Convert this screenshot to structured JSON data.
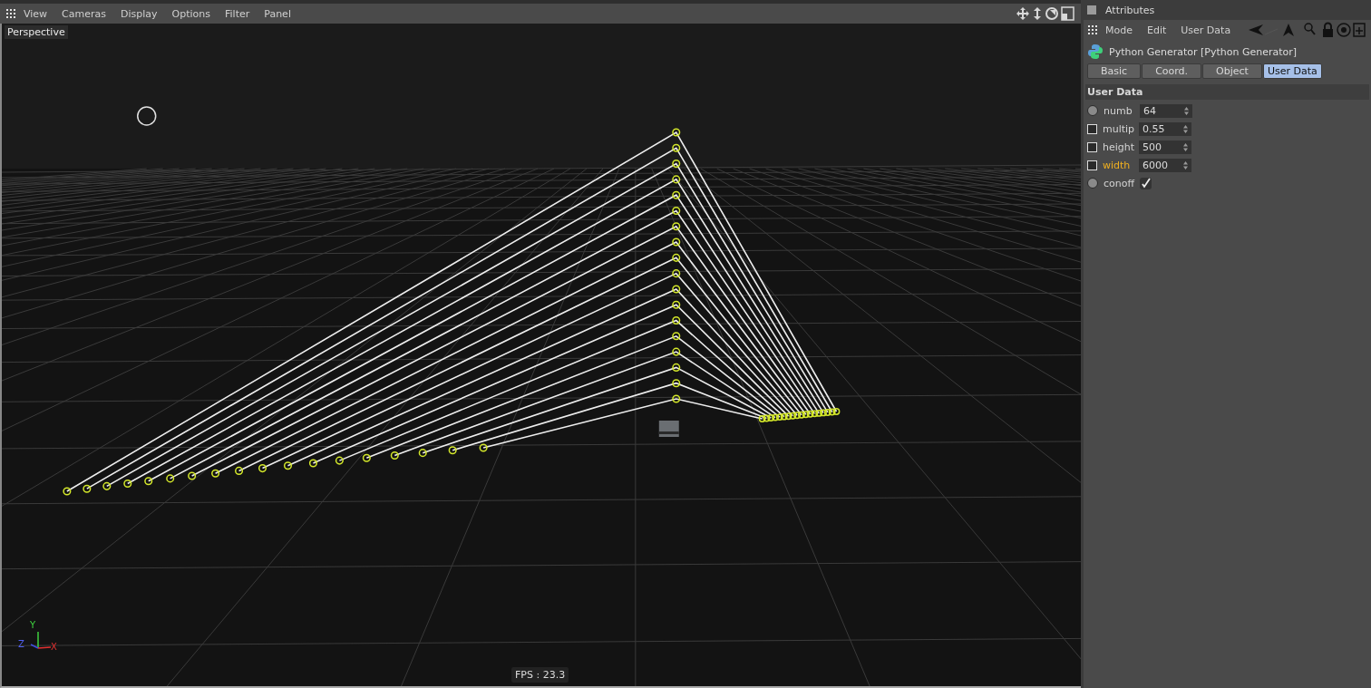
{
  "viewport": {
    "menu": [
      "View",
      "Cameras",
      "Display",
      "Options",
      "Filter",
      "Panel"
    ],
    "camera_label": "Perspective",
    "axis_labels": {
      "y": "Y",
      "z": "Z",
      "x": "X"
    },
    "fps": "FPS : 23.3"
  },
  "attributes": {
    "title": "Attributes",
    "menu": [
      "Mode",
      "Edit",
      "User Data"
    ],
    "object_name": "Python Generator [Python Generator]",
    "tabs": [
      {
        "label": "Basic",
        "selected": false
      },
      {
        "label": "Coord.",
        "selected": false
      },
      {
        "label": "Object",
        "selected": false
      },
      {
        "label": "User Data",
        "selected": true
      }
    ],
    "section": "User Data",
    "params": [
      {
        "kind": "number",
        "label": "numb",
        "value": "64",
        "keyframed": false,
        "highlighted": false
      },
      {
        "kind": "number",
        "label": "multip",
        "value": "0.55",
        "keyframed": true,
        "highlighted": false
      },
      {
        "kind": "number",
        "label": "height",
        "value": "500",
        "keyframed": true,
        "highlighted": false
      },
      {
        "kind": "number",
        "label": "width",
        "value": "6000",
        "keyframed": true,
        "highlighted": true
      },
      {
        "kind": "checkbox",
        "label": "conoff",
        "checked": true,
        "keyframed": false,
        "highlighted": false
      }
    ]
  }
}
